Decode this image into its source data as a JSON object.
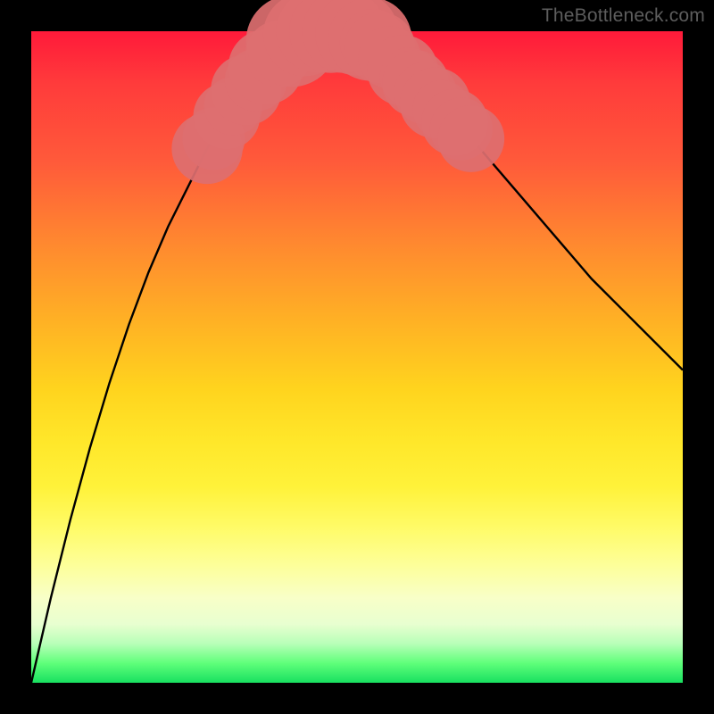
{
  "watermark": "TheBottleneck.com",
  "chart_data": {
    "type": "line",
    "title": "",
    "xlabel": "",
    "ylabel": "",
    "xlim": [
      0,
      100
    ],
    "ylim": [
      0,
      100
    ],
    "series": [
      {
        "name": "bottleneck-curve",
        "x": [
          0,
          3,
          6,
          9,
          12,
          15,
          18,
          21,
          24,
          27,
          30,
          33,
          36,
          39,
          42,
          45,
          48,
          51,
          54,
          58,
          63,
          68,
          74,
          80,
          86,
          92,
          100
        ],
        "y": [
          0,
          13,
          25,
          36,
          46,
          55,
          63,
          70,
          76,
          82,
          87,
          91,
          94,
          97,
          99,
          100,
          100,
          99,
          97,
          94,
          89,
          83,
          76,
          69,
          62,
          56,
          48
        ]
      }
    ],
    "markers": [
      {
        "x": 27,
        "y": 82,
        "r": 1.7
      },
      {
        "x": 28,
        "y": 83.5,
        "r": 1.5
      },
      {
        "x": 30,
        "y": 87,
        "r": 1.6
      },
      {
        "x": 31,
        "y": 88.5,
        "r": 1.4
      },
      {
        "x": 33,
        "y": 91,
        "r": 1.7
      },
      {
        "x": 34.5,
        "y": 92.5,
        "r": 1.5
      },
      {
        "x": 36,
        "y": 94.5,
        "r": 1.8
      },
      {
        "x": 38,
        "y": 96.5,
        "r": 1.6
      },
      {
        "x": 40,
        "y": 98.5,
        "r": 2.2
      },
      {
        "x": 42,
        "y": 99.5,
        "r": 2.0
      },
      {
        "x": 44,
        "y": 100,
        "r": 2.0
      },
      {
        "x": 46,
        "y": 100,
        "r": 2.0
      },
      {
        "x": 48,
        "y": 100,
        "r": 2.0
      },
      {
        "x": 50,
        "y": 99.6,
        "r": 2.0
      },
      {
        "x": 52,
        "y": 98.8,
        "r": 2.0
      },
      {
        "x": 52.5,
        "y": 98.3,
        "r": 1.6
      },
      {
        "x": 53.5,
        "y": 97.5,
        "r": 1.7
      },
      {
        "x": 55,
        "y": 96,
        "r": 1.5
      },
      {
        "x": 57,
        "y": 94,
        "r": 1.7
      },
      {
        "x": 58,
        "y": 93,
        "r": 1.4
      },
      {
        "x": 59,
        "y": 92,
        "r": 1.6
      },
      {
        "x": 60.5,
        "y": 90.5,
        "r": 1.5
      },
      {
        "x": 62,
        "y": 89,
        "r": 1.7
      },
      {
        "x": 63,
        "y": 88,
        "r": 1.4
      },
      {
        "x": 65,
        "y": 86,
        "r": 1.6
      },
      {
        "x": 66,
        "y": 85,
        "r": 1.5
      },
      {
        "x": 67.5,
        "y": 83.5,
        "r": 1.6
      }
    ],
    "marker_color": "#dd6f70",
    "curve_color": "#000000"
  }
}
